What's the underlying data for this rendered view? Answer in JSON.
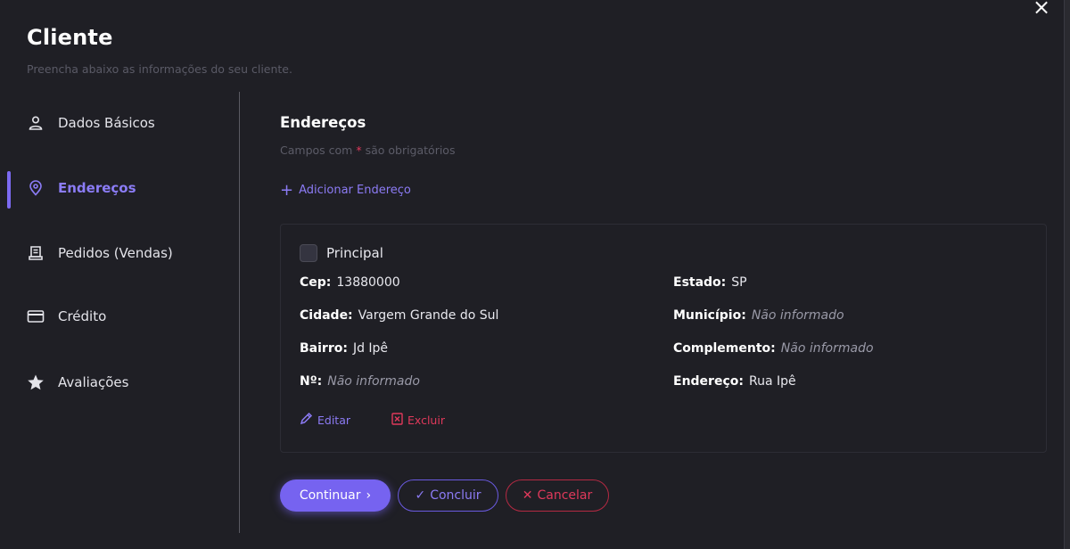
{
  "window": {
    "close_icon": "×"
  },
  "header": {
    "title": "Cliente",
    "subtitle": "Preencha abaixo as informações do seu cliente."
  },
  "sidebar": {
    "items": [
      {
        "label": "Dados Básicos",
        "icon": "user-icon",
        "active": false
      },
      {
        "label": "Endereços",
        "icon": "location-pin-icon",
        "active": true
      },
      {
        "label": "Pedidos (Vendas)",
        "icon": "receipt-icon",
        "active": false
      },
      {
        "label": "Crédito",
        "icon": "credit-card-icon",
        "active": false
      },
      {
        "label": "Avaliações",
        "icon": "star-icon",
        "active": false
      }
    ]
  },
  "main": {
    "section_title": "Endereços",
    "required_note_prefix": "Campos com",
    "required_star": "*",
    "required_note_suffix": "são obrigatórios",
    "add_address_label": "Adicionar Endereço",
    "address_card": {
      "principal_label": "Principal",
      "principal_checked": false,
      "fields": {
        "cep": {
          "label": "Cep:",
          "value": "13880000"
        },
        "estado": {
          "label": "Estado:",
          "value": "SP"
        },
        "cidade": {
          "label": "Cidade:",
          "value": "Vargem Grande do Sul"
        },
        "municipio": {
          "label": "Município:",
          "value": "Não informado"
        },
        "bairro": {
          "label": "Bairro:",
          "value": "Jd Ipê"
        },
        "complemento": {
          "label": "Complemento:",
          "value": "Não informado"
        },
        "numero": {
          "label": "Nº:",
          "value": "Não informado"
        },
        "endereco": {
          "label": "Endereço:",
          "value": "Rua Ipê"
        }
      },
      "edit_label": "Editar",
      "delete_label": "Excluir"
    }
  },
  "footer": {
    "continue_label": "Continuar",
    "continue_icon": "›",
    "conclude_icon": "✓",
    "conclude_label": "Concluir",
    "cancel_icon": "✕",
    "cancel_label": "Cancelar"
  },
  "colors": {
    "accent": "#7663f0",
    "danger": "#e0395b",
    "background": "#1f1f25"
  }
}
